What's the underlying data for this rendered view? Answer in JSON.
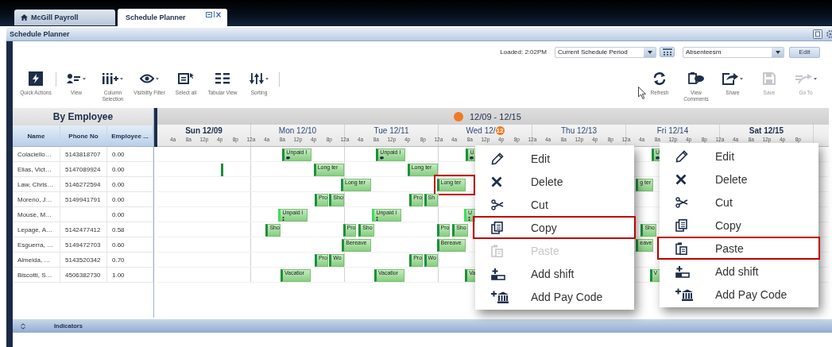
{
  "tabs": [
    {
      "label": "McGill Payroll",
      "selected": false,
      "kind": "home"
    },
    {
      "label": "Schedule Planner",
      "selected": true,
      "kind": "planner"
    }
  ],
  "panel": {
    "title": "Schedule Planner"
  },
  "topbar": {
    "loaded": "Loaded: 2:02PM",
    "period": "Current Schedule Period",
    "view": "Absenteesm",
    "edit": "Edit"
  },
  "toolbar_left": [
    {
      "kind": "quick",
      "label": "Quick Actions",
      "menu": false
    },
    {
      "kind": "view",
      "label": "View",
      "menu": true
    },
    {
      "kind": "columns",
      "label": "Column Selection",
      "menu": true
    },
    {
      "kind": "visibility",
      "label": "Visibility Filter",
      "menu": true
    },
    {
      "kind": "selectall",
      "label": "Select all",
      "menu": false
    },
    {
      "kind": "tabular",
      "label": "Tabular View",
      "menu": false
    },
    {
      "kind": "sorting",
      "label": "Sorting",
      "menu": true
    }
  ],
  "toolbar_right": [
    {
      "kind": "refresh",
      "label": "Refresh",
      "menu": false,
      "disabled": false
    },
    {
      "kind": "comments",
      "label": "View Comments",
      "menu": false,
      "disabled": false
    },
    {
      "kind": "share",
      "label": "Share",
      "menu": true,
      "disabled": false
    },
    {
      "kind": "save",
      "label": "Save",
      "menu": false,
      "disabled": true
    },
    {
      "kind": "goto",
      "label": "Go To",
      "menu": true,
      "disabled": true
    }
  ],
  "employee_panel": {
    "title": "By Employee",
    "columns": [
      "Name",
      "Phone No",
      "Employee ..."
    ]
  },
  "range": "12/09 - 12/15",
  "days": [
    {
      "label": "Sun 12/09",
      "weekend": true,
      "ticks": [
        "4a",
        "8a",
        "12p",
        "4p",
        "8p",
        "12a"
      ]
    },
    {
      "label": "Mon 12/10",
      "weekend": false,
      "ticks": [
        "4a",
        "8a",
        "12p",
        "4p",
        "8p",
        "12a"
      ]
    },
    {
      "label": "Tue 12/11",
      "weekend": false,
      "ticks": [
        "4a",
        "8a",
        "12p",
        "4p",
        "8p",
        "12a"
      ]
    },
    {
      "label": "Wed 12/",
      "badge": "12",
      "weekend": false,
      "ticks": [
        "4a",
        "8a",
        "12p",
        "4p",
        "8p",
        "12a"
      ]
    },
    {
      "label": "Thu 12/13",
      "weekend": false,
      "ticks": [
        "4a",
        "8a",
        "12p",
        "4p",
        "8p",
        "12a"
      ]
    },
    {
      "label": "Fri 12/14",
      "weekend": false,
      "ticks": [
        "4a",
        "8a",
        "12p",
        "4p",
        "8p",
        "12a"
      ]
    },
    {
      "label": "Sat 12/15",
      "weekend": true,
      "ticks": [
        "4a",
        "8a",
        "12p",
        "4p",
        "8p"
      ]
    }
  ],
  "rows": [
    {
      "name": "Colaciello…",
      "phone": "5143818707",
      "employee": "0.00",
      "shifts": [
        {
          "label": "Unpaid l",
          "kind": "note"
        },
        {
          "label": "Unpaid l",
          "kind": "note"
        },
        {
          "label": "U",
          "kind": "note"
        },
        {
          "label": "U",
          "kind": "note"
        }
      ]
    },
    {
      "name": "Elias, Vict…",
      "phone": "5147089924",
      "employee": "0.00",
      "shifts": [
        {
          "kind": "marker"
        },
        {
          "label": "Long ter",
          "kind": "plain"
        },
        {
          "label": "Long ter",
          "kind": "plain"
        }
      ]
    },
    {
      "name": "Law, Chris…",
      "phone": "5146272594",
      "employee": "0.00",
      "shifts": [
        {
          "label": "Long ter",
          "kind": "plain"
        },
        {
          "label": "Long ter",
          "kind": "plain",
          "highlighted": true
        },
        {
          "label": "g ter",
          "kind": "plain"
        }
      ]
    },
    {
      "name": "Moreno, J…",
      "phone": "5149941791",
      "employee": "0.00",
      "shifts": [
        {
          "label": "Pro",
          "kind": "plain"
        },
        {
          "label": "Sho",
          "kind": "plain"
        },
        {
          "label": "Pro",
          "kind": "plain"
        },
        {
          "label": "Sh",
          "kind": "plain"
        }
      ]
    },
    {
      "name": "Mouse, M…",
      "employee": "0.00",
      "shifts": [
        {
          "label": "Unpaid l",
          "kind": "group"
        },
        {
          "label": "Unpaid l",
          "kind": "group"
        },
        {
          "label": "U",
          "kind": "group"
        }
      ]
    },
    {
      "name": "Lepage, A…",
      "phone": "5142477412",
      "employee": "0.58",
      "shifts": [
        {
          "label": "Sho",
          "kind": "plain"
        },
        {
          "label": "Pro",
          "kind": "plain"
        },
        {
          "label": "Sho",
          "kind": "plain"
        },
        {
          "label": "Pro",
          "kind": "plain"
        },
        {
          "label": "Sho",
          "kind": "plain"
        },
        {
          "label": "Sho",
          "kind": "plain"
        }
      ]
    },
    {
      "name": "Esguerra, …",
      "phone": "5149472703",
      "employee": "0.60",
      "shifts": [
        {
          "label": "Bereave",
          "kind": "plain"
        },
        {
          "label": "Bereave",
          "kind": "plain"
        },
        {
          "label": "eave",
          "kind": "plain"
        }
      ]
    },
    {
      "name": "Almeida, …",
      "phone": "5143520342",
      "employee": "0.70",
      "shifts": [
        {
          "label": "Pro",
          "kind": "plain"
        },
        {
          "label": "Wo",
          "kind": "plain"
        },
        {
          "label": "Pro",
          "kind": "plain"
        },
        {
          "label": "Wo",
          "kind": "plain"
        }
      ]
    },
    {
      "name": "Biscotti, S…",
      "phone": "4506382730",
      "employee": "1.00",
      "shifts": [
        {
          "label": "Vacatior",
          "kind": "plain"
        },
        {
          "label": "Vacatior",
          "kind": "plain"
        },
        {
          "label": "Va",
          "kind": "plain"
        },
        {
          "label": "V",
          "kind": "plain"
        }
      ]
    }
  ],
  "menus": [
    {
      "items": [
        {
          "kind": "edit",
          "label": "Edit",
          "disabled": false,
          "highlighted": false
        },
        {
          "kind": "delete",
          "label": "Delete",
          "disabled": false,
          "highlighted": false
        },
        {
          "kind": "cut",
          "label": "Cut",
          "disabled": false,
          "highlighted": false
        },
        {
          "kind": "copy",
          "label": "Copy",
          "disabled": false,
          "highlighted": true
        },
        {
          "kind": "paste",
          "label": "Paste",
          "disabled": true,
          "highlighted": false
        },
        {
          "kind": "addshift",
          "label": "Add shift",
          "disabled": false,
          "highlighted": false
        },
        {
          "kind": "paycode",
          "label": "Add Pay Code",
          "disabled": false,
          "highlighted": false
        }
      ]
    },
    {
      "items": [
        {
          "kind": "edit",
          "label": "Edit",
          "disabled": false,
          "highlighted": false
        },
        {
          "kind": "delete",
          "label": "Delete",
          "disabled": false,
          "highlighted": false
        },
        {
          "kind": "cut",
          "label": "Cut",
          "disabled": false,
          "highlighted": false
        },
        {
          "kind": "copy",
          "label": "Copy",
          "disabled": false,
          "highlighted": false
        },
        {
          "kind": "paste",
          "label": "Paste",
          "disabled": false,
          "highlighted": true
        },
        {
          "kind": "addshift",
          "label": "Add shift",
          "disabled": false,
          "highlighted": false
        },
        {
          "kind": "paycode",
          "label": "Add Pay Code",
          "disabled": false,
          "highlighted": false
        }
      ]
    }
  ],
  "indicators": {
    "label": "Indicators"
  }
}
